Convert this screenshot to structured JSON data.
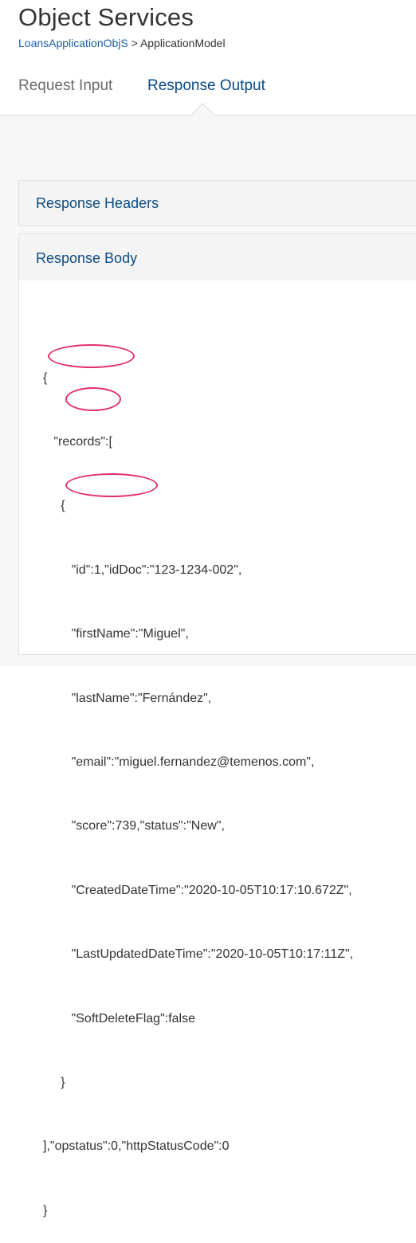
{
  "header": {
    "title": "Object Services",
    "breadcrumb_link": "LoansApplicationObjS",
    "breadcrumb_sep": " > ",
    "breadcrumb_current": "ApplicationModel"
  },
  "tabs": [
    {
      "label": "Request Input",
      "active": false
    },
    {
      "label": "Response Output",
      "active": true
    }
  ],
  "sections": {
    "headers_label": "Response Headers",
    "body_label": "Response Body"
  },
  "response_body": {
    "lines": [
      "{",
      "   \"records\":[",
      "     {",
      "        \"id\":1,\"idDoc\":\"123-1234-002\",",
      "        \"firstName\":\"Miguel\",",
      "        \"lastName\":\"Fernández\",",
      "        \"email\":\"miguel.fernandez@temenos.com\",",
      "        \"score\":739,\"status\":\"New\",",
      "        \"CreatedDateTime\":\"2020-10-05T10:17:10.672Z\",",
      "        \"LastUpdatedDateTime\":\"2020-10-05T10:17:11Z\",",
      "        \"SoftDeleteFlag\":false",
      "     }",
      "],\"opstatus\":0,\"httpStatusCode\":0",
      "}"
    ]
  },
  "colors": {
    "accent": "#0b4a84",
    "link": "#1b5faa",
    "highlight": "#e2306c"
  }
}
